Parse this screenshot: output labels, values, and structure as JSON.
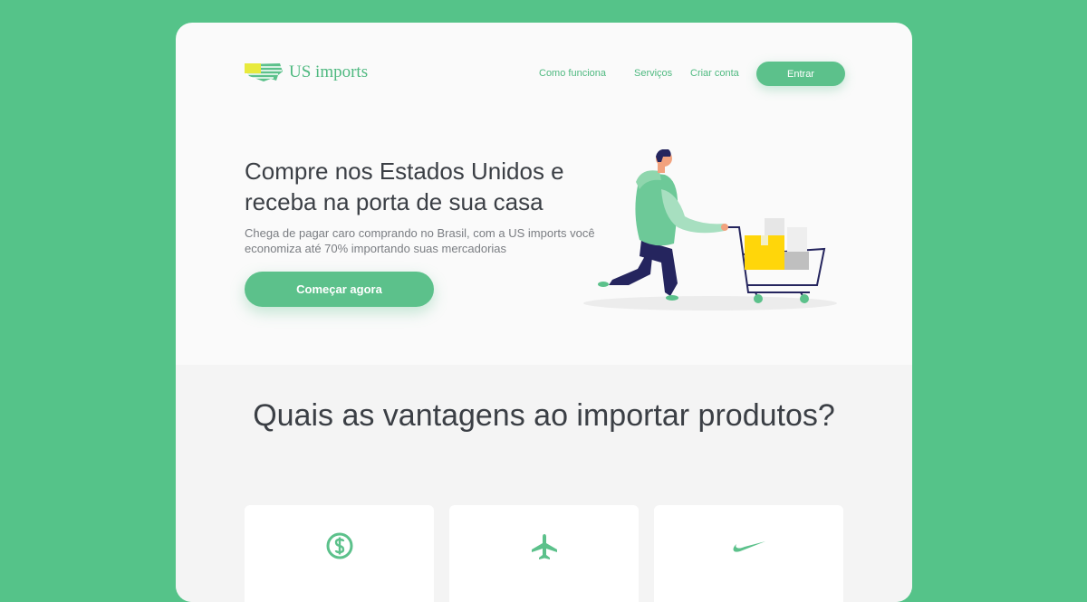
{
  "brand": {
    "name": "US imports",
    "logo_icon": "us-map-flag-icon"
  },
  "nav": {
    "links": [
      "Como funciona",
      "Serviços",
      "Criar conta"
    ],
    "login_label": "Entrar"
  },
  "hero": {
    "title": "Compre nos Estados Unidos e receba na porta de sua casa",
    "subtitle": "Chega de pagar caro comprando no Brasil, com a US imports você economiza até 70% importando suas mercadorias",
    "cta_label": "Começar agora",
    "illustration": "man-pushing-shopping-cart"
  },
  "advantages": {
    "title": "Quais as vantagens ao importar produtos?",
    "cards": [
      {
        "icon": "dollar-circle-icon"
      },
      {
        "icon": "airplane-icon"
      },
      {
        "icon": "nike-swoosh-icon"
      }
    ]
  },
  "colors": {
    "background": "#55c389",
    "accent": "#5cc18b",
    "text_dark": "#3b3f45",
    "text_muted": "#7a7d82",
    "navy": "#25255e",
    "yellow": "#ffd60a"
  }
}
